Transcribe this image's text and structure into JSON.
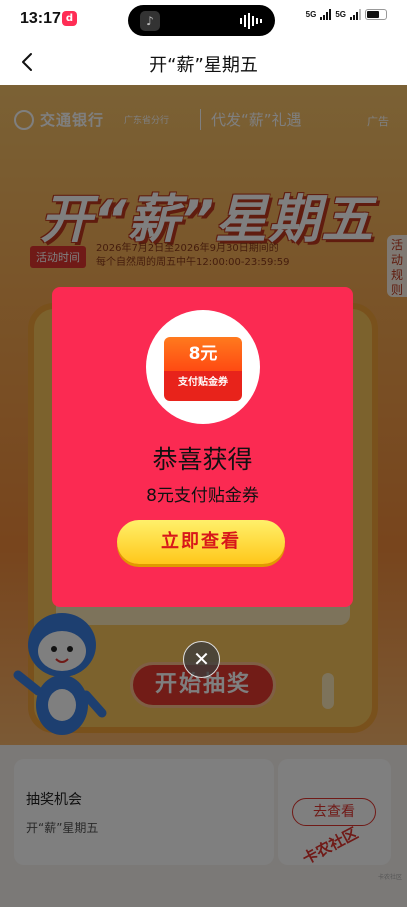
{
  "status_bar": {
    "time": "13:17",
    "app_icon": "d",
    "net_1": "5G",
    "net_2": "5G"
  },
  "nav": {
    "title": "开“薪”星期五",
    "back_icon": "back-chevron-icon"
  },
  "banner": {
    "bank_name": "交通银行",
    "bank_branch": "广东省分行",
    "promo_tag": "代发“薪”礼遇",
    "ad_label": "广告",
    "headline": "开“薪”星期五",
    "activity_time_label": "活动时间",
    "activity_time_text_1": "2026年7月2日至2026年9月30日期间的",
    "activity_time_text_2": "每个自然周的周五中午12:00:00-23:59:59",
    "rules_tab": "活动规则",
    "start_button": "开始抽奖"
  },
  "chance_card": {
    "title": "抽奖机会",
    "subtitle": "开“薪”星期五",
    "view_button": "去查看"
  },
  "watermark": {
    "text": "卡农社区",
    "small": "卡农社区"
  },
  "modal": {
    "coupon_amount": "8元",
    "coupon_label": "支付贴金券",
    "congrats": "恭喜获得",
    "prize_text": "8元支付贴金券",
    "view_now_button": "立即查看",
    "close_icon": "close-icon",
    "colors": {
      "modal_bg": "#fb2a52",
      "button_bg": "#ffd31e",
      "button_text": "#d8171a"
    }
  }
}
